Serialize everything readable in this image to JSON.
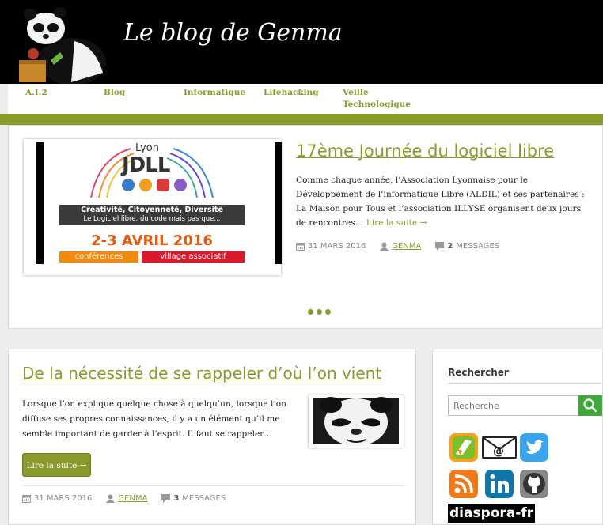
{
  "header": {
    "site_title": "Le blog de Genma"
  },
  "nav": {
    "items": [
      {
        "label": "A.I.2"
      },
      {
        "label": "Blog"
      },
      {
        "label": "Informatique"
      },
      {
        "label": "Lifehacking"
      },
      {
        "label": "Veille\nTechnologique"
      }
    ]
  },
  "slider": {
    "image": {
      "city": "Lyon",
      "logo_text": "JDLL",
      "tagline_line1": "Créativité, Citoyenneté, Diversité",
      "tagline_line2": "Le Logiciel libre, du code mais pas que...",
      "dates": "2-3 AVRIL 2016",
      "label_left": "conférences",
      "label_right": "village associatif"
    },
    "title": "17ème Journée du logiciel libre",
    "excerpt": "Comme chaque année, l’Association Lyonnaise pour le Développement de l’informatique Libre (ALDIL) et ses partenaires : La Maison pour Tous et l’association ILLYSE organisent deux jours de rencontres…",
    "read_more": "Lire la suite →",
    "meta": {
      "date": "31 MARS 2016",
      "author": "GENMA",
      "count": "2",
      "count_label": "MESSAGES"
    }
  },
  "post": {
    "title": "De la nécessité de se rappeler d’où l’on vient",
    "excerpt": "Lorsque l’on explique quelque chose à quelqu’un, lorsque l’on diffuse ses propres connaissances, il y a un élément qu’il me semble important de garder à l’esprit. Il faut se rappeler…",
    "read_more_button": "Lire la suite →",
    "meta": {
      "date": "31 MARS 2016",
      "author": "GENMA",
      "count": "3",
      "count_label": "MESSAGES"
    }
  },
  "sidebar": {
    "search_heading": "Rechercher",
    "search_placeholder": "Recherche",
    "social": [
      {
        "icon": "jabber-icon",
        "color": "#f6a623"
      },
      {
        "icon": "email-icon",
        "color": "#ffffff"
      },
      {
        "icon": "twitter-icon",
        "color": "#1da1f2"
      },
      {
        "icon": "rss-icon",
        "color": "#f07a1a"
      },
      {
        "icon": "linkedin-icon",
        "color": "#0e76a8"
      },
      {
        "icon": "github-icon",
        "color": "#555555"
      }
    ],
    "diaspora_label": "diaspora-fr"
  },
  "colors": {
    "accent": "#8a9a2a",
    "header_bg": "#000000",
    "search_button": "#3ea83a"
  }
}
